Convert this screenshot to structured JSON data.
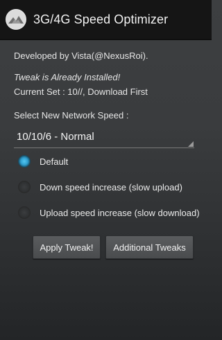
{
  "app": {
    "title": "3G/4G Speed Optimizer",
    "icon": "app-logo-icon"
  },
  "info": {
    "developer": "Developed by Vista(@NexusRoi).",
    "status": "Tweak is Already Installed!",
    "current_set": "Current Set : 10//, Download First"
  },
  "network": {
    "prompt": "Select New Network Speed :",
    "selected": "10/10/6 - Normal"
  },
  "options": [
    {
      "label": "Default",
      "checked": true
    },
    {
      "label": "Down speed increase (slow upload)",
      "checked": false
    },
    {
      "label": "Upload speed increase (slow download)",
      "checked": false
    }
  ],
  "buttons": {
    "apply": "Apply Tweak!",
    "additional": "Additional Tweaks"
  },
  "colors": {
    "action_bar": "#151515",
    "accent": "#33b5e5",
    "background": "#3a3c3e"
  }
}
